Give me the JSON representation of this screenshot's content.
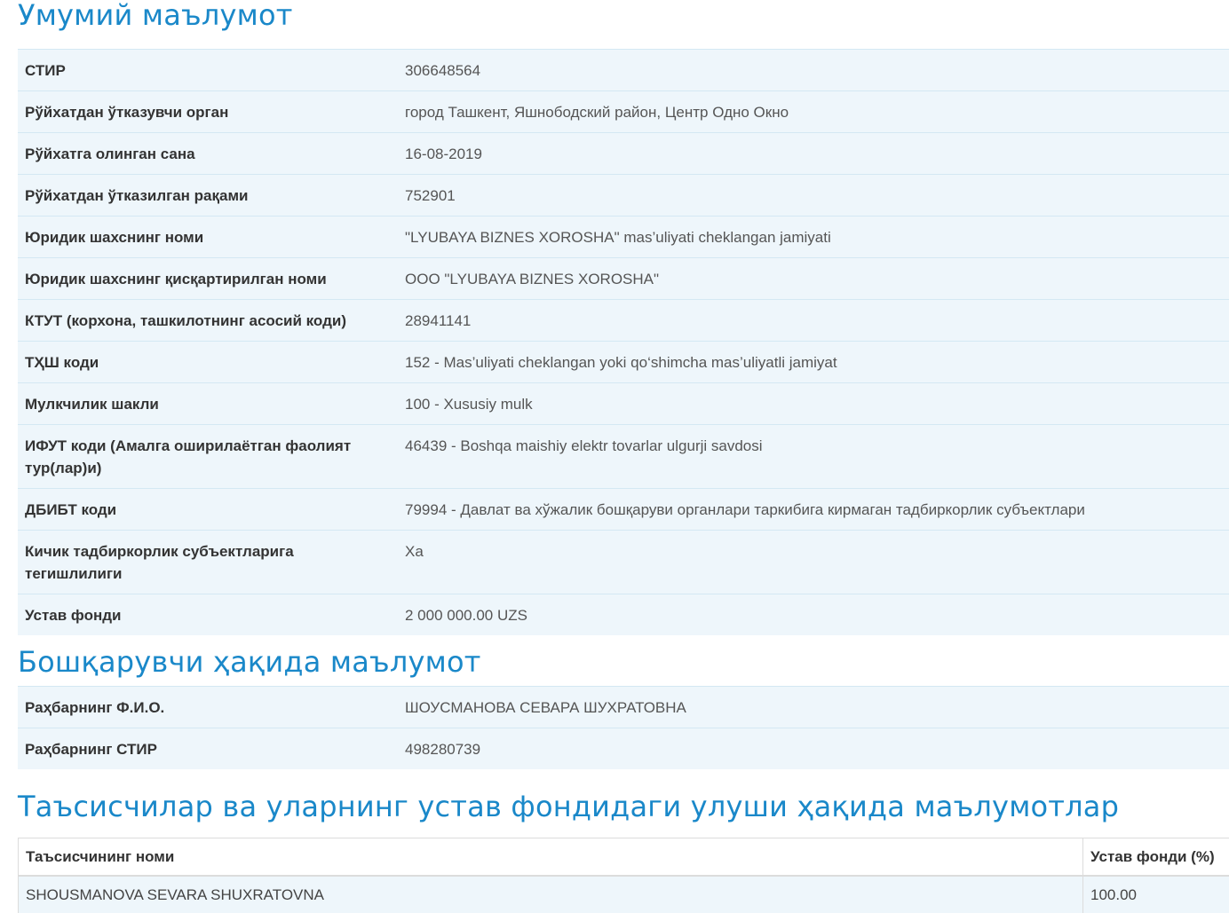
{
  "general": {
    "title": "Умумий маълумот",
    "rows": [
      {
        "label": "СТИР",
        "value": "306648564"
      },
      {
        "label": "Рўйхатдан ўтказувчи орган",
        "value": "город Ташкент, Яшнободский район, Центр Одно Окно"
      },
      {
        "label": "Рўйхатга олинган сана",
        "value": "16-08-2019"
      },
      {
        "label": "Рўйхатдан ўтказилган рақами",
        "value": "752901"
      },
      {
        "label": "Юридик шахснинг номи",
        "value": "\"LYUBAYA BIZNES XOROSHA\" mas’uliyati cheklangan jamiyati"
      },
      {
        "label": "Юридик шахснинг қисқартирилган номи",
        "value": "ООО \"LYUBAYA BIZNES XOROSHA\""
      },
      {
        "label": "КТУТ (корхона, ташкилотнинг асосий коди)",
        "value": "28941141"
      },
      {
        "label": "ТҲШ коди",
        "value": "152 - Mas’uliyati cheklangan yoki qo‘shimcha mas’uliyatli jamiyat"
      },
      {
        "label": "Мулкчилик шакли",
        "value": "100 - Xususiy mulk"
      },
      {
        "label": "ИФУТ коди (Амалга оширилаётган фаолият тур(лар)и)",
        "value": "46439 - Boshqa maishiy elektr tovarlar ulgurji savdosi"
      },
      {
        "label": "ДБИБТ коди",
        "value": "79994 - Давлат ва хўжалик бошқаруви органлари таркибига кирмаган тадбиркорлик субъектлари"
      },
      {
        "label": "Кичик тадбиркорлик субъектларига тегишлилиги",
        "value": "Ха"
      },
      {
        "label": "Устав фонди",
        "value": "2 000 000.00 UZS"
      }
    ]
  },
  "manager": {
    "title": "Бошқарувчи ҳақида маълумот",
    "rows": [
      {
        "label": "Раҳбарнинг Ф.И.О.",
        "value": "ШОУСМАНОВА СЕВАРА ШУХРАТОВНА"
      },
      {
        "label": "Раҳбарнинг СТИР",
        "value": "498280739"
      }
    ]
  },
  "founders": {
    "title": "Таъсисчилар ва уларнинг устав фондидаги улуши ҳақида маълумотлар",
    "columns": [
      "Таъсисчининг номи",
      "Устав фонди (%)"
    ],
    "rows": [
      {
        "name": "SHOUSMANOVA SEVARA SHUXRATOVNA",
        "share": "100.00"
      }
    ]
  },
  "colors": {
    "heading": "#1a88c9",
    "row_bg": "#eef6fb",
    "border": "#d4e8f3"
  }
}
